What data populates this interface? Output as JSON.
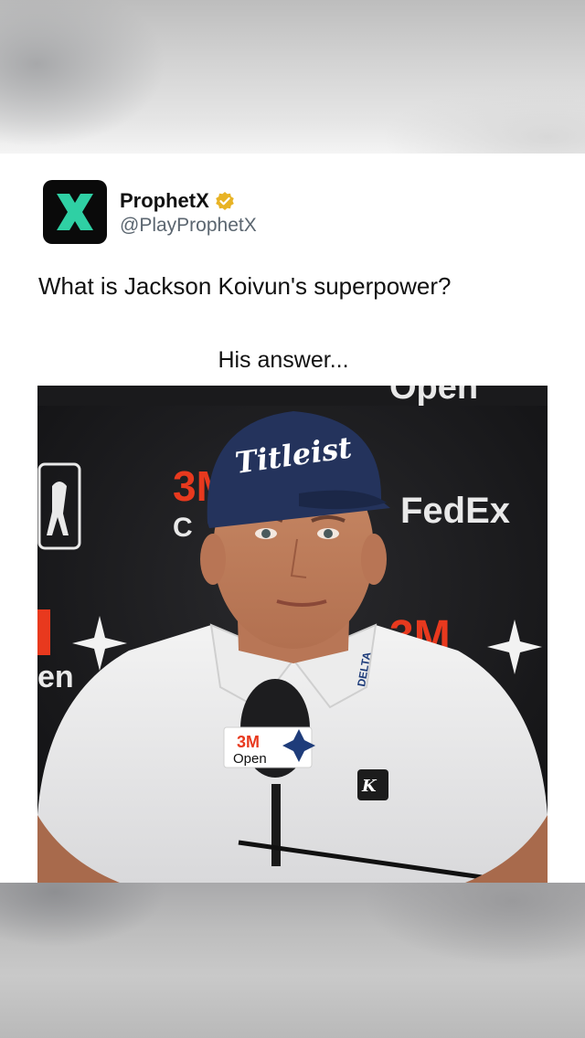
{
  "account": {
    "display_name": "ProphetX",
    "handle": "@PlayProphetX",
    "verified": true,
    "avatar_letter": "X",
    "avatar_color": "#2fd0a4"
  },
  "tweet": {
    "text": "What is Jackson Koivun's superpower?"
  },
  "video": {
    "caption": "His answer...",
    "cap_text": "Titleist",
    "backdrop_logos": [
      "3M",
      "FedEx",
      "Open"
    ],
    "mic_flag_top": "3M",
    "mic_flag_bottom": "Open",
    "collar_sponsor": "DELTA"
  },
  "colors": {
    "accent": "#2fd0a4",
    "verified_badge": "#e8b325",
    "backdrop_red": "#e8391e"
  }
}
